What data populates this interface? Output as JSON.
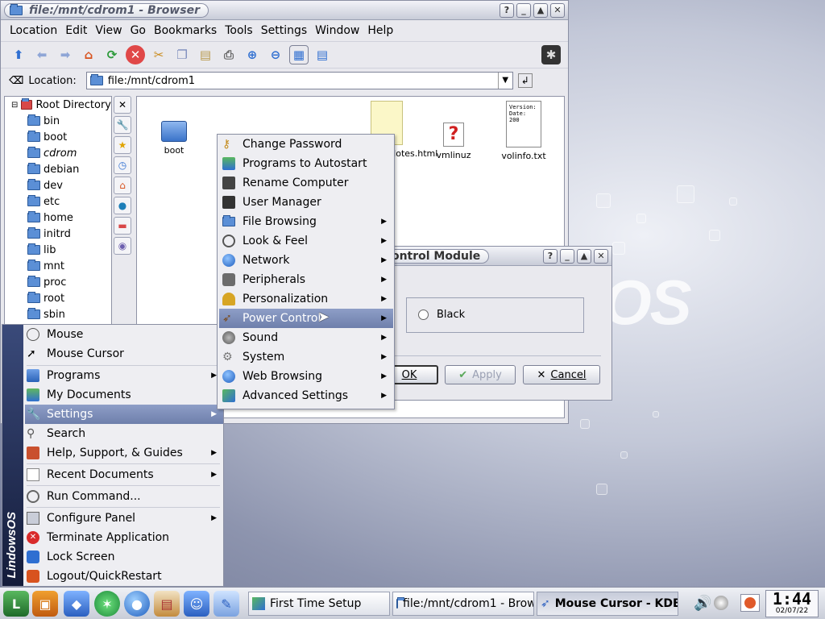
{
  "browser": {
    "title": "file:/mnt/cdrom1 - Browser",
    "menu": [
      "Location",
      "Edit",
      "View",
      "Go",
      "Bookmarks",
      "Tools",
      "Settings",
      "Window",
      "Help"
    ],
    "location_label": "Location:",
    "location_value": "file:/mnt/cdrom1",
    "tree": [
      {
        "label": "Root Directory",
        "root": true
      },
      {
        "label": "bin"
      },
      {
        "label": "boot"
      },
      {
        "label": "cdrom",
        "italic": true
      },
      {
        "label": "debian"
      },
      {
        "label": "dev"
      },
      {
        "label": "etc"
      },
      {
        "label": "home"
      },
      {
        "label": "initrd"
      },
      {
        "label": "lib"
      },
      {
        "label": "mnt"
      },
      {
        "label": "proc"
      },
      {
        "label": "root"
      },
      {
        "label": "sbin"
      }
    ],
    "files": [
      "boot",
      "ReleaseNotes.html",
      "vmlinuz",
      "volinfo.txt"
    ],
    "volinfo_thumb": "Version: Date: 200"
  },
  "dialog": {
    "title": "Mouse Cursor - KDE Control Module",
    "option_label": "Black",
    "ok": "OK",
    "apply": "Apply",
    "cancel": "Cancel"
  },
  "kmenu": {
    "brand": "LindowsOS",
    "items": [
      {
        "label": "Mouse",
        "icon": "mouse-icon"
      },
      {
        "label": "Mouse Cursor",
        "icon": "cursor-icon"
      },
      {
        "label": "Programs",
        "icon": "programs-icon",
        "sub": true
      },
      {
        "label": "My Documents",
        "icon": "documents-icon"
      },
      {
        "label": "Settings",
        "icon": "settings-icon",
        "sub": true,
        "highlight": true
      },
      {
        "label": "Search",
        "icon": "search-icon"
      },
      {
        "label": "Help, Support, & Guides",
        "icon": "help-icon",
        "sub": true
      },
      {
        "label": "Recent Documents",
        "icon": "recent-icon",
        "sub": true
      },
      {
        "label": "Run Command...",
        "icon": "run-icon"
      },
      {
        "label": "Configure Panel",
        "icon": "panel-icon",
        "sub": true
      },
      {
        "label": "Terminate Application",
        "icon": "terminate-icon"
      },
      {
        "label": "Lock Screen",
        "icon": "lock-icon"
      },
      {
        "label": "Logout/QuickRestart",
        "icon": "logout-icon"
      }
    ]
  },
  "settings_menu": {
    "items": [
      {
        "label": "Change Password",
        "icon": "key-icon"
      },
      {
        "label": "Programs to Autostart",
        "icon": "autostart-icon"
      },
      {
        "label": "Rename Computer",
        "icon": "computer-icon"
      },
      {
        "label": "User Manager",
        "icon": "users-icon"
      },
      {
        "label": "File Browsing",
        "icon": "folder-icon",
        "sub": true
      },
      {
        "label": "Look & Feel",
        "icon": "appearance-icon",
        "sub": true
      },
      {
        "label": "Network",
        "icon": "network-icon",
        "sub": true
      },
      {
        "label": "Peripherals",
        "icon": "peripherals-icon",
        "sub": true
      },
      {
        "label": "Personalization",
        "icon": "personal-icon",
        "sub": true
      },
      {
        "label": "Power Control",
        "icon": "power-icon",
        "sub": true,
        "highlight": true
      },
      {
        "label": "Sound",
        "icon": "sound-icon",
        "sub": true
      },
      {
        "label": "System",
        "icon": "system-icon",
        "sub": true
      },
      {
        "label": "Web Browsing",
        "icon": "web-icon",
        "sub": true
      },
      {
        "label": "Advanced Settings",
        "icon": "advanced-icon",
        "sub": true
      }
    ]
  },
  "taskbar": {
    "tasks": [
      {
        "label": "First Time Setup",
        "active": false
      },
      {
        "label": "file:/mnt/cdrom1 - Brow",
        "active": false
      },
      {
        "label": "Mouse Cursor - KDE",
        "active": true
      }
    ],
    "time": "1:44",
    "date": "02/07/22"
  },
  "colors": {
    "highlight": "#7788b5",
    "accent": "#3a4a7a",
    "close_red": "#d92b2b"
  }
}
